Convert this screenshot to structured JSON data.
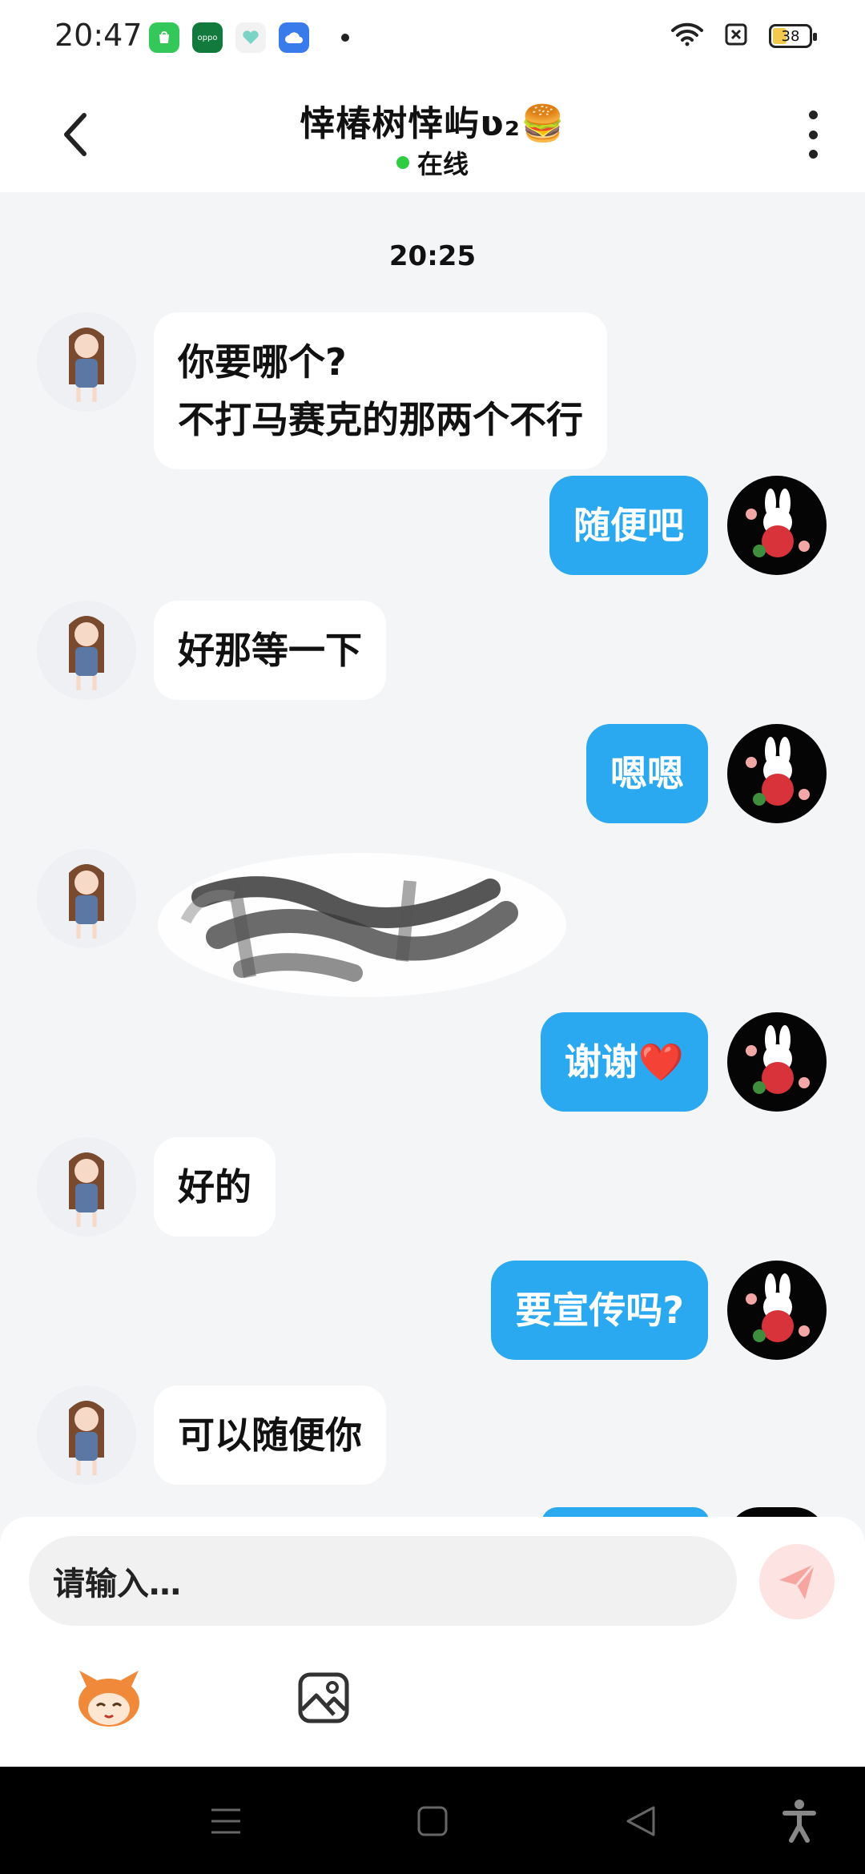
{
  "status_bar": {
    "time": "20:47",
    "battery_level": "38",
    "app_icons": [
      {
        "name": "app-store-icon",
        "color": "#34c759"
      },
      {
        "name": "oppo-icon",
        "label": "oppo",
        "color": "#127a3c"
      },
      {
        "name": "health-icon",
        "color": "#f2f2f2"
      },
      {
        "name": "cloud-icon",
        "color": "#3a7bec"
      }
    ],
    "icons": [
      "wifi-icon",
      "sim-off-icon",
      "battery-icon"
    ]
  },
  "header": {
    "title": "悻椿树悻屿ʋ₂🍔",
    "presence": "在线",
    "presence_color": "#2ecc40",
    "icons": [
      "back-arrow-icon",
      "more-vertical-icon"
    ]
  },
  "chat": {
    "timestamp": "20:25",
    "messages": [
      {
        "side": "left",
        "text": "你要哪个?\n不打马赛克的那两个不行"
      },
      {
        "side": "right",
        "text": "随便吧"
      },
      {
        "side": "left",
        "text": "好那等一下"
      },
      {
        "side": "right",
        "text": "嗯嗯"
      },
      {
        "side": "left",
        "type": "censored-image"
      },
      {
        "side": "right",
        "text": "谢谢❤️"
      },
      {
        "side": "left",
        "text": "好的"
      },
      {
        "side": "right",
        "text": "要宣传吗?"
      },
      {
        "side": "left",
        "text": "可以随便你"
      }
    ],
    "colors": {
      "outgoing_bubble": "#2aa8f0",
      "incoming_bubble": "#ffffff",
      "background": "#f4f5f7"
    }
  },
  "composer": {
    "placeholder": "请输入…",
    "icons": [
      "send-icon",
      "emoji-mascot-icon",
      "image-picker-icon"
    ]
  },
  "nav_bar": {
    "icons": [
      "menu-icon",
      "home-icon",
      "back-icon",
      "accessibility-icon"
    ]
  }
}
